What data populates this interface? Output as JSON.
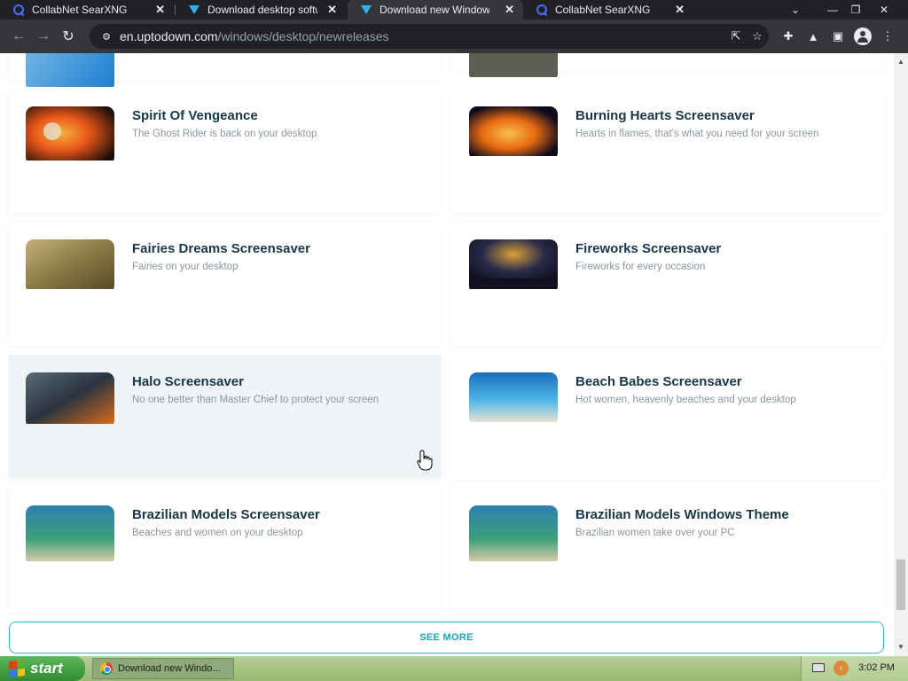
{
  "browser": {
    "tabs": [
      {
        "title": "CollabNet SearXNG",
        "favicon": "search-icon"
      },
      {
        "title": "Download desktop software",
        "favicon": "uptodown-icon"
      },
      {
        "title": "Download new Windows",
        "favicon": "uptodown-icon",
        "active": true
      },
      {
        "title": "CollabNet SearXNG",
        "favicon": "search-icon"
      }
    ],
    "url_host": "en.uptodown.com",
    "url_path": "/windows/desktop/newreleases"
  },
  "page": {
    "apps": [
      {
        "name": "Spirit Of Vengeance",
        "tagline": "The Ghost Rider is back on your desktop",
        "thumb_colors": [
          "#1a0d08",
          "#e8561a",
          "#f6b23a"
        ]
      },
      {
        "name": "Burning Hearts Screensaver",
        "tagline": "Hearts in flames, that's what you need for your screen",
        "thumb_colors": [
          "#0d0a1e",
          "#e86a12",
          "#f7c04a"
        ]
      },
      {
        "name": "Fairies Dreams Screensaver",
        "tagline": "Fairies on your desktop",
        "thumb_colors": [
          "#5a4a2a",
          "#c7b079",
          "#8a7a45"
        ]
      },
      {
        "name": "Fireworks Screensaver",
        "tagline": "Fireworks for every occasion",
        "thumb_colors": [
          "#0b0b18",
          "#d9a23a",
          "#2a2a4a"
        ]
      },
      {
        "name": "Halo Screensaver",
        "tagline": "No one better than Master Chief to protect your screen",
        "thumb_colors": [
          "#2a3440",
          "#d96a1a",
          "#5b6a72"
        ]
      },
      {
        "name": "Beach Babes Screensaver",
        "tagline": "Hot women, heavenly beaches and your desktop",
        "thumb_colors": [
          "#1a6fb8",
          "#4bb5e8",
          "#e9e3d2"
        ]
      },
      {
        "name": "Brazilian Models Screensaver",
        "tagline": "Beaches and women on your desktop",
        "thumb_colors": [
          "#2f7fb0",
          "#3aa07a",
          "#d8c9a7"
        ]
      },
      {
        "name": "Brazilian Models Windows Theme",
        "tagline": "Brazilian women take over your PC",
        "thumb_colors": [
          "#2f7fb0",
          "#3aa07a",
          "#d8c9a7"
        ]
      }
    ],
    "see_more": "SEE MORE"
  },
  "taskbar": {
    "start_label": "start",
    "task_label": "Download new Windo...",
    "clock": "3:02 PM"
  }
}
